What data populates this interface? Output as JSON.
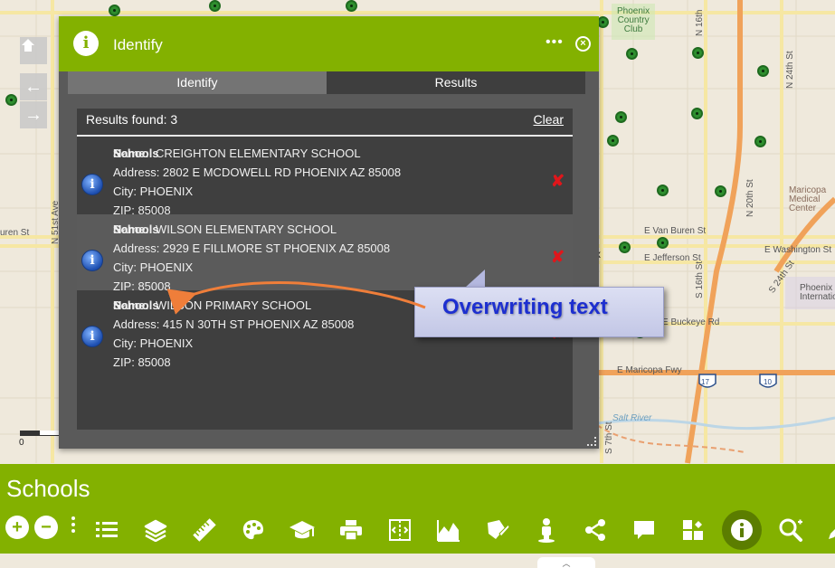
{
  "map": {
    "labels": {
      "phoenix_country_club": "Phoenix\nCountry\nClub",
      "maricopa_medical_center": "Maricopa\nMedical\nCenter",
      "phoenix_international": "Phoenix\nInternatio",
      "e_van_buren": "E Van Buren St",
      "e_jefferson": "E Jefferson St",
      "e_washington": "E Washington St",
      "buren_st": "uren St",
      "e_buckeye": "E Buckeye Rd",
      "e_maricopa_fwy": "E Maricopa Fwy",
      "salt_river": "Salt River",
      "n_51st_ave": "N 51st Ave",
      "n_24th_st": "N 24th St",
      "n_20th_st": "N 20th St",
      "n_16th_st": "N 16th",
      "s_16th_st": "S 16th St",
      "s_7th_st": "S 7th St",
      "s_24th_st": "S 24th St",
      "highway_17": "17",
      "highway_10": "10",
      "scale_zero": "0",
      "partial_x": "x"
    },
    "nav": {
      "home_icon": "home-icon",
      "back_arrow": "←",
      "forward_arrow": "→"
    }
  },
  "panel": {
    "title": "Identify",
    "info_glyph": "i",
    "more_glyph": "•••",
    "close_glyph": "×",
    "tabs": [
      {
        "label": "Identify",
        "active": true
      },
      {
        "label": "Results",
        "active": false
      }
    ],
    "results_found": "Results found: 3",
    "clear_label": "Clear",
    "results": [
      {
        "field_label": "Name:",
        "layer_label": "Schools",
        "name": "CREIGHTON ELEMENTARY SCHOOL",
        "address": "Address: 2802 E MCDOWELL RD PHOENIX AZ 85008",
        "city": "City: PHOENIX",
        "zip": "ZIP: 85008",
        "highlighted": false
      },
      {
        "field_label": "Name:",
        "layer_label": "Schools",
        "name": "WILSON ELEMENTARY SCHOOL",
        "address": "Address: 2929 E FILLMORE ST PHOENIX AZ 85008",
        "city": "City: PHOENIX",
        "zip": "ZIP: 85008",
        "highlighted": true
      },
      {
        "field_label": "Name:",
        "layer_label": "Schools",
        "name": "WILSON PRIMARY SCHOOL",
        "address": "Address: 415 N 30TH ST PHOENIX AZ 85008",
        "city": "City: PHOENIX",
        "zip": "ZIP: 85008",
        "highlighted": false
      }
    ],
    "result_icon_glyph": "i",
    "remove_glyph": "✘"
  },
  "annotation": {
    "text": "Overwriting text"
  },
  "toolbar": {
    "title": "Schools",
    "zoom_in": "+",
    "zoom_out": "−",
    "handle": "•••",
    "bottom_tab_glyph": "︿",
    "tools": [
      "legend-list-icon",
      "layers-icon",
      "measure-ruler-icon",
      "basemap-palette-icon",
      "schools-mortarboard-icon",
      "print-icon",
      "swipe-icon",
      "elevation-profile-icon",
      "draw-icon",
      "street-view-person-icon",
      "share-icon",
      "comment-icon",
      "widget-grid-icon",
      "identify-info-icon",
      "search-zoom-icon",
      "edit-icon"
    ],
    "active_tool": "identify-info-icon"
  },
  "colors": {
    "accent_green": "#83b100",
    "panel_body": "#5a5a5a",
    "results_bg": "#3f3f3f",
    "remove_red": "#e0161b",
    "callout_text": "#1d2fd0",
    "arrow_orange": "#ef7e3a"
  }
}
